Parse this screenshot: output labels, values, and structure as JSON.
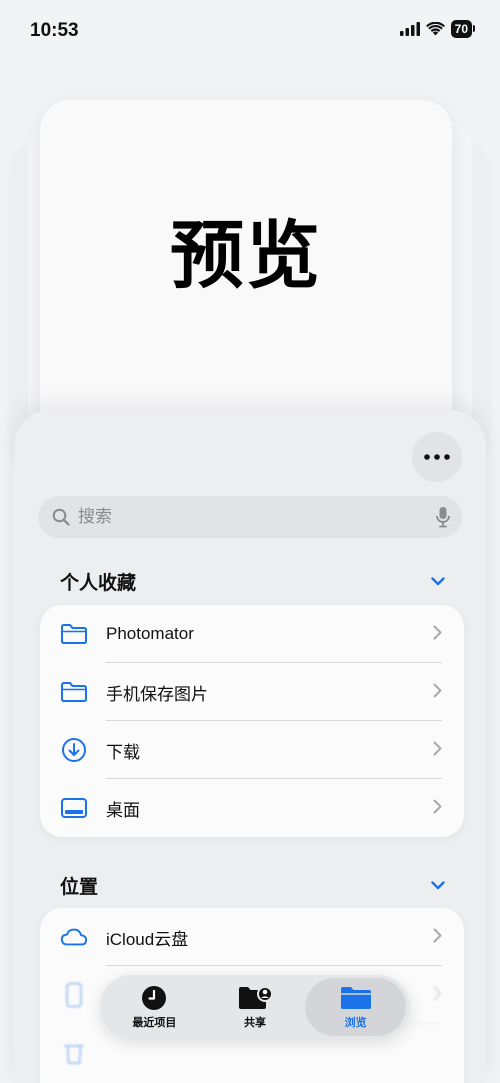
{
  "status_bar": {
    "time": "10:53",
    "battery": "70"
  },
  "preview": {
    "title": "预览"
  },
  "search": {
    "placeholder": "搜索"
  },
  "favorites": {
    "title": "个人收藏",
    "items": [
      {
        "label": "Photomator",
        "icon": "folder-icon"
      },
      {
        "label": "手机保存图片",
        "icon": "folder-icon"
      },
      {
        "label": "下载",
        "icon": "download-icon"
      },
      {
        "label": "桌面",
        "icon": "desktop-icon"
      }
    ]
  },
  "locations": {
    "title": "位置",
    "items": [
      {
        "label": "iCloud云盘",
        "icon": "cloud-icon"
      }
    ]
  },
  "tab_bar": {
    "tabs": [
      {
        "label": "最近项目",
        "icon": "clock-icon"
      },
      {
        "label": "共享",
        "icon": "shared-folder-icon"
      },
      {
        "label": "浏览",
        "icon": "folder-icon",
        "active": true
      }
    ]
  },
  "colors": {
    "accent": "#1a73e8",
    "background": "#f2f3f5",
    "card": "#fbfbfc"
  }
}
